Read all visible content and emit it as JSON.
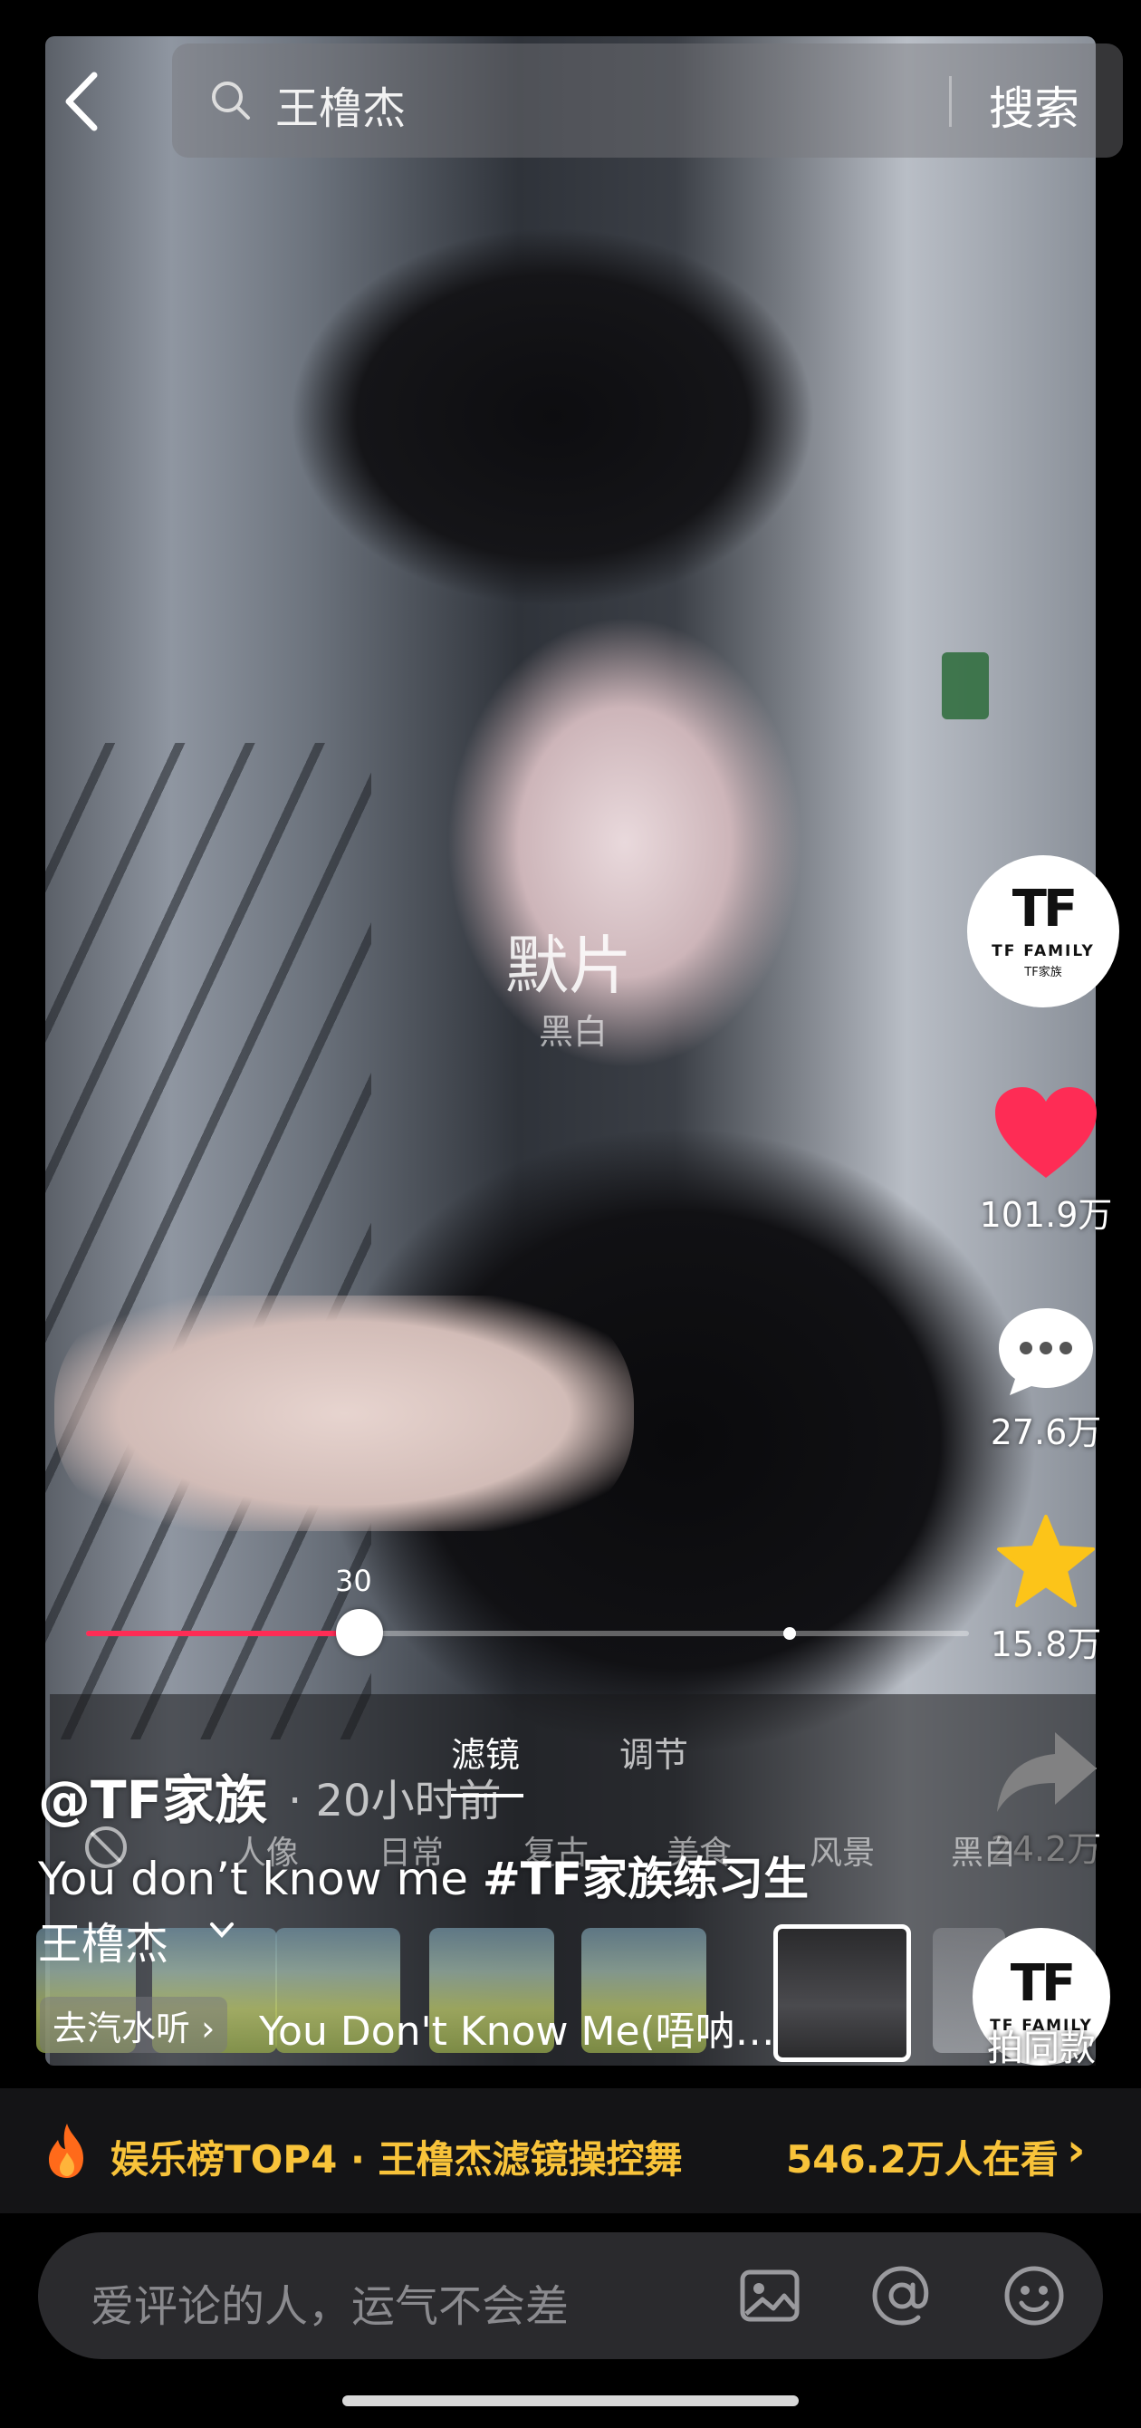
{
  "search": {
    "query": "王橹杰",
    "button": "搜索"
  },
  "overlay": {
    "filter_name": "默片",
    "filter_category": "黑白"
  },
  "actions": {
    "like_count": "101.9万",
    "comment_count": "27.6万",
    "favorite_count": "15.8万",
    "share_count": "24.2万",
    "same_style_label": "拍同款"
  },
  "account_logo": {
    "mark": "TF",
    "name": "TF FAMILY",
    "sub": "TF家族"
  },
  "progress": {
    "value_label": "30",
    "fraction": 0.31
  },
  "filter_panel": {
    "tabs": [
      "滤镜",
      "调节"
    ],
    "categories": [
      "人像",
      "日常",
      "复古",
      "美食",
      "风景",
      "黑白"
    ]
  },
  "post": {
    "author": "@TF家族",
    "time": "· 20小时前",
    "caption_text": "You don’t know me ",
    "caption_hashtag": "#TF家族练习生",
    "mention": "王橹杰"
  },
  "music": {
    "pill": "去汽水听 ›",
    "title": "You Don't Know Me(唔呐…"
  },
  "trending": {
    "text": "娱乐榜TOP4 · 王橹杰滤镜操控舞",
    "viewers": "546.2万人在看",
    "arrow": "›"
  },
  "comment_input": {
    "placeholder": "爱评论的人，运气不会差"
  },
  "colors": {
    "accent": "#fe2c55",
    "trend": "#f8c33a"
  },
  "icons": [
    "back-icon",
    "search-icon",
    "heart-icon",
    "comment-icon",
    "star-icon",
    "share-icon",
    "no-filter-icon",
    "fire-icon",
    "image-icon",
    "at-icon",
    "emoji-icon"
  ]
}
